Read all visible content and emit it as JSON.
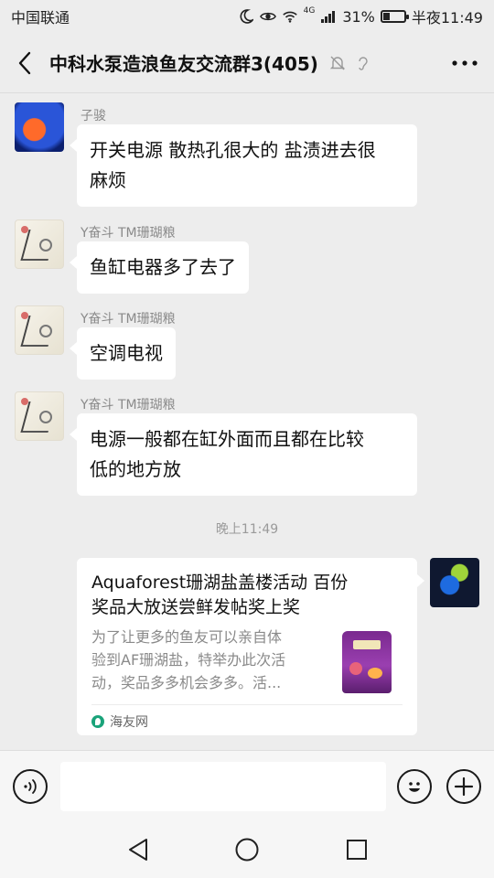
{
  "status_bar": {
    "carrier": "中国联通",
    "network": "4G",
    "battery_percent": "31%",
    "battery_level": 0.31,
    "time": "半夜11:49"
  },
  "header": {
    "title": "中科水泵造浪鱼友交流群3(405)",
    "icons": [
      "back-icon",
      "mute-bell-icon",
      "earpiece-icon",
      "more-icon"
    ]
  },
  "messages": [
    {
      "sender": "子骏",
      "text_lines": [
        "开关电源 散热孔很大的 盐渍进去很",
        "麻烦"
      ]
    },
    {
      "sender": "Y奋斗 TM珊瑚粮",
      "text_lines": [
        "鱼缸电器多了去了"
      ]
    },
    {
      "sender": "Y奋斗 TM珊瑚粮",
      "text_lines": [
        "空调电视"
      ]
    },
    {
      "sender": "Y奋斗 TM珊瑚粮",
      "text_lines": [
        "电源一般都在缸外面而且都在比较",
        "低的地方放"
      ]
    }
  ],
  "timestamp": "晚上11:49",
  "link_card": {
    "title_lines": [
      "Aquaforest珊湖盐盖楼活动 百份",
      "奖品大放送尝鲜发帖奖上奖"
    ],
    "desc_lines": [
      "为了让更多的鱼友可以亲自体",
      "验到AF珊湖盐，特举办此次活",
      "动，奖品多多机会多多。活..."
    ],
    "source": "海友网"
  },
  "input_bar": {
    "icons": [
      "voice-icon",
      "emoji-icon",
      "plus-icon"
    ],
    "text_value": ""
  },
  "nav_bar": {
    "icons": [
      "back-triangle-icon",
      "home-circle-icon",
      "recents-square-icon"
    ]
  }
}
